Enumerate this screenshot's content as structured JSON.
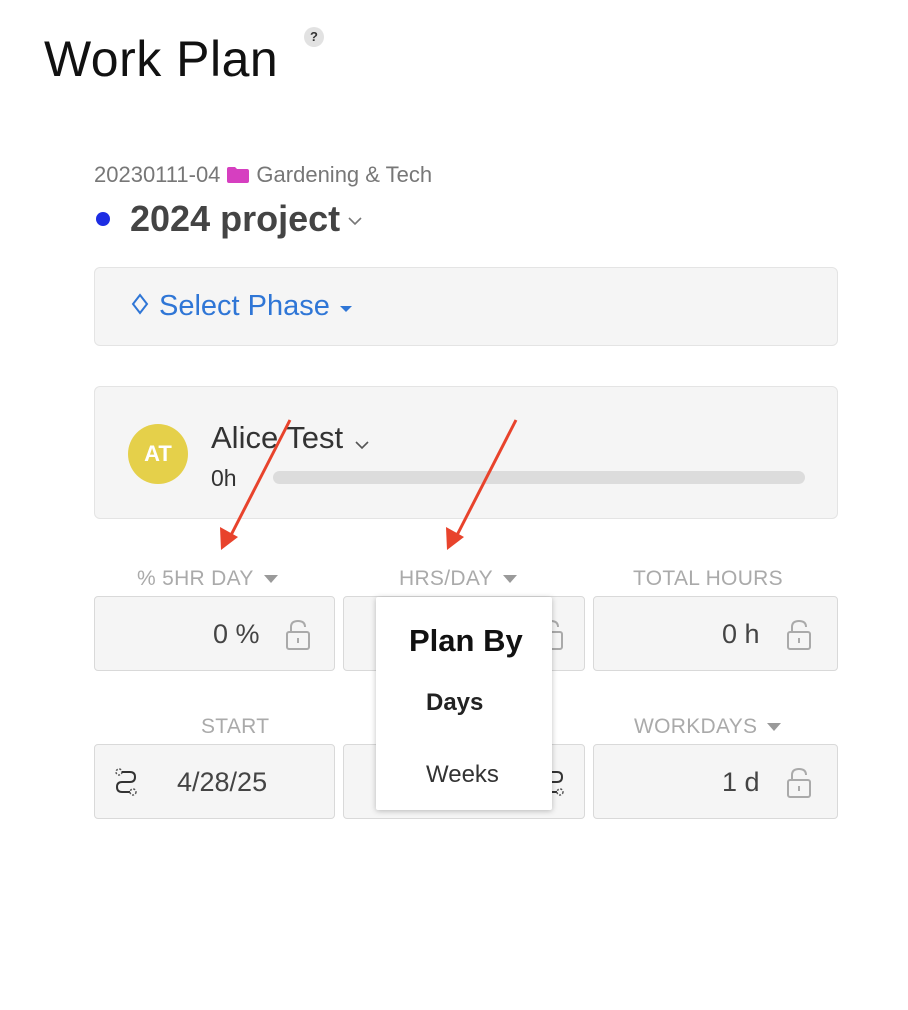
{
  "page": {
    "title": "Work Plan",
    "help_icon": "?"
  },
  "project": {
    "code": "20230111-04",
    "folder_icon": "folder-icon",
    "folder_color": "#d63fc0",
    "client": "Gardening & Tech",
    "dot_color": "#1d2de3",
    "name": "2024 project"
  },
  "phase": {
    "label": "Select Phase",
    "icon": "diamond-icon",
    "color": "#2f76d6"
  },
  "member": {
    "initials": "AT",
    "avatar_color": "#e5d04a",
    "name": "Alice Test",
    "hours": "0h",
    "progress": 0
  },
  "fields": {
    "percent": {
      "label": "% 5HR DAY",
      "value": "0 %"
    },
    "hrs_per_day": {
      "label": "HRS/DAY"
    },
    "total_hours": {
      "label": "TOTAL HOURS",
      "value": "0 h"
    },
    "start": {
      "label": "START",
      "value": "4/28/25"
    },
    "workdays": {
      "label": "WORKDAYS",
      "value": "1 d"
    }
  },
  "plan_by_menu": {
    "title": "Plan By",
    "items": [
      {
        "label": "Days",
        "selected": true
      },
      {
        "label": "Weeks",
        "selected": false
      }
    ]
  },
  "annotation": {
    "arrow_color": "#e8432c"
  }
}
